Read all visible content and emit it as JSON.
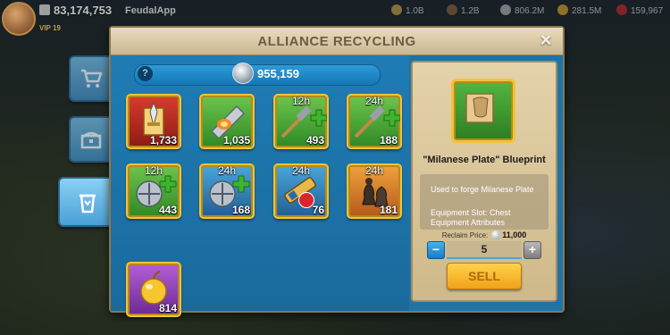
{
  "hud": {
    "power": "83,174,753",
    "player_name": "FeudalApp",
    "vip": "VIP 19",
    "resources": [
      {
        "icon": "food-icon",
        "value": "1.0B",
        "color": "#d9b04b"
      },
      {
        "icon": "wood-icon",
        "value": "1.2B",
        "color": "#9b6a3a"
      },
      {
        "icon": "stone-icon",
        "value": "806.2M",
        "color": "#c6c6c6"
      },
      {
        "icon": "gold-icon",
        "value": "281.5M",
        "color": "#f0b428"
      },
      {
        "icon": "gem-icon",
        "value": "159,967",
        "color": "#d9262b"
      }
    ]
  },
  "sidebar": {
    "tabs": [
      {
        "name": "shop-tab",
        "icon": "cart-icon",
        "active": false
      },
      {
        "name": "chest-tab",
        "icon": "chest-icon",
        "active": false
      },
      {
        "name": "recycling-tab",
        "icon": "recycle-icon",
        "active": true
      }
    ]
  },
  "dialog": {
    "title": "ALLIANCE RECYCLING",
    "close_label": "×",
    "silver_balance": "955,159",
    "help_label": "?"
  },
  "items": [
    {
      "name": "item-red-rune",
      "icon": "sword-rune-icon",
      "color": "red",
      "qty": "1,733",
      "timer": ""
    },
    {
      "name": "item-feather-horn",
      "icon": "horn-icon",
      "color": "green",
      "qty": "1,035",
      "timer": ""
    },
    {
      "name": "item-speedup-12h",
      "icon": "hammer-speedup-icon",
      "color": "green",
      "qty": "493",
      "timer": "12h"
    },
    {
      "name": "item-speedup-24h",
      "icon": "hammer-speedup-icon",
      "color": "green",
      "qty": "188",
      "timer": "24h"
    },
    {
      "name": "item-heal-12h",
      "icon": "healing-speedup-icon",
      "color": "green",
      "qty": "443",
      "timer": "12h"
    },
    {
      "name": "item-heal-24h",
      "icon": "healing-speedup-icon",
      "color": "blue",
      "qty": "168",
      "timer": "24h"
    },
    {
      "name": "item-telescope-24h",
      "icon": "telescope-icon",
      "color": "blue",
      "qty": "76",
      "timer": "24h"
    },
    {
      "name": "item-chess-24h",
      "icon": "chess-icon",
      "color": "orange",
      "qty": "181",
      "timer": "24h"
    },
    {
      "name": "item-golden-apple",
      "icon": "golden-apple-icon",
      "color": "purple",
      "qty": "814",
      "timer": ""
    }
  ],
  "detail": {
    "name": "\"Milanese Plate\" Blueprint",
    "desc_line1": "Used to forge Milanese Plate",
    "desc_line2": "Equipment Slot: Chest",
    "desc_line3": "Equipment Attributes",
    "reclaim_label": "Reclaim Price:",
    "reclaim_value": "11,000",
    "quantity": "5",
    "minus_label": "−",
    "plus_label": "+",
    "sell_label": "SELL"
  }
}
